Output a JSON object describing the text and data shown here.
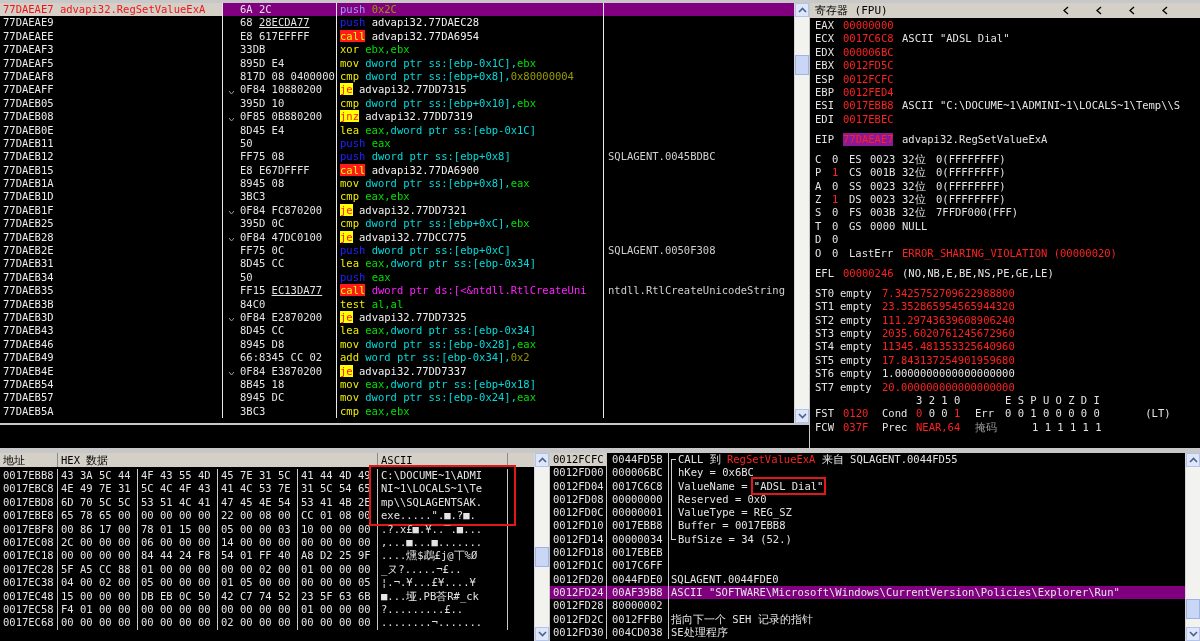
{
  "disassembly": {
    "rows": [
      {
        "address": "77DAEAE7",
        "label": "advapi32.RegSetValueExA",
        "current": true,
        "selected": true,
        "jump": false,
        "hex": "6A 2C",
        "reloc": false,
        "kind": "push",
        "mnemonic": "push",
        "operands": [
          {
            "kind": "imm",
            "text": "0x2C"
          }
        ]
      },
      {
        "address": "77DAEAE9",
        "current": false,
        "selected": false,
        "jump": false,
        "hex": "68 28ECDA77",
        "reloc": true,
        "kind": "push",
        "mnemonic": "push",
        "operands": [
          {
            "kind": "addr",
            "text": "advapi32.77DAEC28"
          }
        ]
      },
      {
        "address": "77DAEAEE",
        "current": false,
        "selected": false,
        "jump": false,
        "hex": "E8 617EFFFF",
        "reloc": false,
        "kind": "call",
        "mnemonic": "call",
        "operands": [
          {
            "kind": "addr",
            "text": "advapi32.77DA6954"
          }
        ]
      },
      {
        "address": "77DAEAF3",
        "current": false,
        "selected": false,
        "jump": false,
        "hex": "33DB",
        "reloc": false,
        "kind": "op",
        "mnemonic": "xor",
        "operands": [
          {
            "kind": "reg",
            "text": "ebx,ebx"
          }
        ]
      },
      {
        "address": "77DAEAF5",
        "current": false,
        "selected": false,
        "jump": false,
        "hex": "895D E4",
        "reloc": false,
        "kind": "op",
        "mnemonic": "mov",
        "operands": [
          {
            "kind": "mem",
            "text": "dword ptr ss:[ebp-0x1C],"
          },
          {
            "kind": "reg",
            "text": "ebx"
          }
        ]
      },
      {
        "address": "77DAEAF8",
        "current": false,
        "selected": false,
        "jump": false,
        "hex": "817D 08 0400000",
        "reloc": false,
        "kind": "op",
        "mnemonic": "cmp",
        "operands": [
          {
            "kind": "mem",
            "text": "dword ptr ss:[ebp+0x8],"
          },
          {
            "kind": "imm",
            "text": "0x80000004"
          }
        ]
      },
      {
        "address": "77DAEAFF",
        "current": false,
        "selected": false,
        "jump": true,
        "hex": "0F84 10880200",
        "reloc": false,
        "kind": "jump",
        "mnemonic": "je",
        "operands": [
          {
            "kind": "addr",
            "text": "advapi32.77DD7315"
          }
        ]
      },
      {
        "address": "77DAEB05",
        "current": false,
        "selected": false,
        "jump": false,
        "hex": "395D 10",
        "reloc": false,
        "kind": "op",
        "mnemonic": "cmp",
        "operands": [
          {
            "kind": "mem",
            "text": "dword ptr ss:[ebp+0x10],"
          },
          {
            "kind": "reg",
            "text": "ebx"
          }
        ]
      },
      {
        "address": "77DAEB08",
        "current": false,
        "selected": false,
        "jump": true,
        "hex": "0F85 0B880200",
        "reloc": false,
        "kind": "jump",
        "mnemonic": "jnz",
        "operands": [
          {
            "kind": "addr",
            "text": "advapi32.77DD7319"
          }
        ]
      },
      {
        "address": "77DAEB0E",
        "current": false,
        "selected": false,
        "jump": false,
        "hex": "8D45 E4",
        "reloc": false,
        "kind": "op",
        "mnemonic": "lea",
        "operands": [
          {
            "kind": "reg",
            "text": "eax,"
          },
          {
            "kind": "mem",
            "text": "dword ptr ss:[ebp-0x1C]"
          }
        ]
      },
      {
        "address": "77DAEB11",
        "current": false,
        "selected": false,
        "jump": false,
        "hex": "50",
        "reloc": false,
        "kind": "push",
        "mnemonic": "push",
        "operands": [
          {
            "kind": "reg",
            "text": "eax"
          }
        ]
      },
      {
        "address": "77DAEB12",
        "current": false,
        "selected": false,
        "jump": false,
        "hex": "FF75 08",
        "reloc": false,
        "kind": "push",
        "mnemonic": "push",
        "operands": [
          {
            "kind": "mem",
            "text": "dword ptr ss:[ebp+0x8]"
          }
        ],
        "comment": "SQLAGENT.0045BDBC"
      },
      {
        "address": "77DAEB15",
        "current": false,
        "selected": false,
        "jump": false,
        "hex": "E8 E67DFFFF",
        "reloc": false,
        "kind": "call",
        "mnemonic": "call",
        "operands": [
          {
            "kind": "addr",
            "text": "advapi32.77DA6900"
          }
        ]
      },
      {
        "address": "77DAEB1A",
        "current": false,
        "selected": false,
        "jump": false,
        "hex": "8945 08",
        "reloc": false,
        "kind": "op",
        "mnemonic": "mov",
        "operands": [
          {
            "kind": "mem",
            "text": "dword ptr ss:[ebp+0x8],"
          },
          {
            "kind": "reg",
            "text": "eax"
          }
        ]
      },
      {
        "address": "77DAEB1D",
        "current": false,
        "selected": false,
        "jump": false,
        "hex": "3BC3",
        "reloc": false,
        "kind": "op",
        "mnemonic": "cmp",
        "operands": [
          {
            "kind": "reg",
            "text": "eax,ebx"
          }
        ]
      },
      {
        "address": "77DAEB1F",
        "current": false,
        "selected": false,
        "jump": true,
        "hex": "0F84 FC870200",
        "reloc": false,
        "kind": "jump",
        "mnemonic": "je",
        "operands": [
          {
            "kind": "addr",
            "text": "advapi32.77DD7321"
          }
        ]
      },
      {
        "address": "77DAEB25",
        "current": false,
        "selected": false,
        "jump": false,
        "hex": "395D 0C",
        "reloc": false,
        "kind": "op",
        "mnemonic": "cmp",
        "operands": [
          {
            "kind": "mem",
            "text": "dword ptr ss:[ebp+0xC],"
          },
          {
            "kind": "reg",
            "text": "ebx"
          }
        ]
      },
      {
        "address": "77DAEB28",
        "current": false,
        "selected": false,
        "jump": true,
        "hex": "0F84 47DC0100",
        "reloc": false,
        "kind": "jump",
        "mnemonic": "je",
        "operands": [
          {
            "kind": "addr",
            "text": "advapi32.77DCC775"
          }
        ]
      },
      {
        "address": "77DAEB2E",
        "current": false,
        "selected": false,
        "jump": false,
        "hex": "FF75 0C",
        "reloc": false,
        "kind": "push",
        "mnemonic": "push",
        "operands": [
          {
            "kind": "mem",
            "text": "dword ptr ss:[ebp+0xC]"
          }
        ],
        "comment": "SQLAGENT.0050F308"
      },
      {
        "address": "77DAEB31",
        "current": false,
        "selected": false,
        "jump": false,
        "hex": "8D45 CC",
        "reloc": false,
        "kind": "op",
        "mnemonic": "lea",
        "operands": [
          {
            "kind": "reg",
            "text": "eax,"
          },
          {
            "kind": "mem",
            "text": "dword ptr ss:[ebp-0x34]"
          }
        ]
      },
      {
        "address": "77DAEB34",
        "current": false,
        "selected": false,
        "jump": false,
        "hex": "50",
        "reloc": false,
        "kind": "push",
        "mnemonic": "push",
        "operands": [
          {
            "kind": "reg",
            "text": "eax"
          }
        ]
      },
      {
        "address": "77DAEB35",
        "current": false,
        "selected": false,
        "jump": false,
        "hex": "FF15 EC13DA77",
        "reloc": true,
        "kind": "call",
        "mnemonic": "call",
        "operands": [
          {
            "kind": "ind",
            "text": "dword ptr ds:[<&ntdll.RtlCreateUni"
          }
        ],
        "comment": "ntdll.RtlCreateUnicodeString"
      },
      {
        "address": "77DAEB3B",
        "current": false,
        "selected": false,
        "jump": false,
        "hex": "84C0",
        "reloc": false,
        "kind": "op",
        "mnemonic": "test",
        "operands": [
          {
            "kind": "reg",
            "text": "al,al"
          }
        ]
      },
      {
        "address": "77DAEB3D",
        "current": false,
        "selected": false,
        "jump": true,
        "hex": "0F84 E2870200",
        "reloc": false,
        "kind": "jump",
        "mnemonic": "je",
        "operands": [
          {
            "kind": "addr",
            "text": "advapi32.77DD7325"
          }
        ]
      },
      {
        "address": "77DAEB43",
        "current": false,
        "selected": false,
        "jump": false,
        "hex": "8D45 CC",
        "reloc": false,
        "kind": "op",
        "mnemonic": "lea",
        "operands": [
          {
            "kind": "reg",
            "text": "eax,"
          },
          {
            "kind": "mem",
            "text": "dword ptr ss:[ebp-0x34]"
          }
        ]
      },
      {
        "address": "77DAEB46",
        "current": false,
        "selected": false,
        "jump": false,
        "hex": "8945 D8",
        "reloc": false,
        "kind": "op",
        "mnemonic": "mov",
        "operands": [
          {
            "kind": "mem",
            "text": "dword ptr ss:[ebp-0x28],"
          },
          {
            "kind": "reg",
            "text": "eax"
          }
        ]
      },
      {
        "address": "77DAEB49",
        "current": false,
        "selected": false,
        "jump": false,
        "hex": "66:8345 CC 02",
        "reloc": false,
        "kind": "op",
        "mnemonic": "add",
        "operands": [
          {
            "kind": "mem",
            "text": "word ptr ss:[ebp-0x34],"
          },
          {
            "kind": "imm",
            "text": "0x2"
          }
        ]
      },
      {
        "address": "77DAEB4E",
        "current": false,
        "selected": false,
        "jump": true,
        "hex": "0F84 E3870200",
        "reloc": false,
        "kind": "jump",
        "mnemonic": "je",
        "operands": [
          {
            "kind": "addr",
            "text": "advapi32.77DD7337"
          }
        ]
      },
      {
        "address": "77DAEB54",
        "current": false,
        "selected": false,
        "jump": false,
        "hex": "8B45 18",
        "reloc": false,
        "kind": "op",
        "mnemonic": "mov",
        "operands": [
          {
            "kind": "reg",
            "text": "eax,"
          },
          {
            "kind": "mem",
            "text": "dword ptr ss:[ebp+0x18]"
          }
        ]
      },
      {
        "address": "77DAEB57",
        "current": false,
        "selected": false,
        "jump": false,
        "hex": "8945 DC",
        "reloc": false,
        "kind": "op",
        "mnemonic": "mov",
        "operands": [
          {
            "kind": "mem",
            "text": "dword ptr ss:[ebp-0x24],"
          },
          {
            "kind": "reg",
            "text": "eax"
          }
        ]
      },
      {
        "address": "77DAEB5A",
        "current": false,
        "selected": false,
        "jump": false,
        "hex": "3BC3",
        "reloc": false,
        "kind": "op",
        "mnemonic": "cmp",
        "operands": [
          {
            "kind": "reg",
            "text": "eax,ebx"
          }
        ]
      }
    ]
  },
  "registers": {
    "title": "寄存器 (FPU)",
    "general": [
      {
        "name": "EAX",
        "value": "00000000",
        "changed": true
      },
      {
        "name": "ECX",
        "value": "0017C6C8",
        "changed": true,
        "comment": "ASCII \"ADSL Dial\""
      },
      {
        "name": "EDX",
        "value": "000006BC",
        "changed": true
      },
      {
        "name": "EBX",
        "value": "0012FD5C",
        "changed": true
      },
      {
        "name": "ESP",
        "value": "0012FCFC",
        "changed": true
      },
      {
        "name": "EBP",
        "value": "0012FED4",
        "changed": true
      },
      {
        "name": "ESI",
        "value": "0017EBB8",
        "changed": true,
        "comment": "ASCII \"C:\\DOCUME~1\\ADMINI~1\\LOCALS~1\\Temp\\\\S"
      },
      {
        "name": "EDI",
        "value": "0017EBEC",
        "changed": true
      }
    ],
    "eip": {
      "name": "EIP",
      "value": "77DAEAE7",
      "selected": true,
      "comment": "advapi32.RegSetValueExA"
    },
    "flags": [
      {
        "name": "C",
        "value": "0",
        "changed": false,
        "segment": {
          "name": "ES",
          "selector": "0023",
          "bits": "32位",
          "base": "0(FFFFFFFF)"
        }
      },
      {
        "name": "P",
        "value": "1",
        "changed": true,
        "segment": {
          "name": "CS",
          "selector": "001B",
          "bits": "32位",
          "base": "0(FFFFFFFF)"
        }
      },
      {
        "name": "A",
        "value": "0",
        "changed": false,
        "segment": {
          "name": "SS",
          "selector": "0023",
          "bits": "32位",
          "base": "0(FFFFFFFF)"
        }
      },
      {
        "name": "Z",
        "value": "1",
        "changed": true,
        "segment": {
          "name": "DS",
          "selector": "0023",
          "bits": "32位",
          "base": "0(FFFFFFFF)"
        }
      },
      {
        "name": "S",
        "value": "0",
        "changed": false,
        "segment": {
          "name": "FS",
          "selector": "003B",
          "bits": "32位",
          "base": "7FFDF000(FFF)"
        }
      },
      {
        "name": "T",
        "value": "0",
        "changed": false,
        "segment": {
          "name": "GS",
          "selector": "0000",
          "note": "NULL"
        }
      },
      {
        "name": "D",
        "value": "0",
        "changed": false
      },
      {
        "name": "O",
        "value": "0",
        "changed": false,
        "last_error": {
          "label": "LastErr",
          "value": "ERROR_SHARING_VIOLATION (00000020)"
        }
      }
    ],
    "efl": {
      "name": "EFL",
      "value": "00000246",
      "changed": true,
      "comment": "(NO,NB,E,BE,NS,PE,GE,LE)"
    },
    "fpu_stack": [
      {
        "name": "ST0",
        "tag": "empty",
        "value": "7.3425752709622988800",
        "changed": true
      },
      {
        "name": "ST1",
        "tag": "empty",
        "value": "23.352865954565944320",
        "changed": true
      },
      {
        "name": "ST2",
        "tag": "empty",
        "value": "111.29743639608906240",
        "changed": true
      },
      {
        "name": "ST3",
        "tag": "empty",
        "value": "2035.6020761245672960",
        "changed": true
      },
      {
        "name": "ST4",
        "tag": "empty",
        "value": "11345.481353325640960",
        "changed": true
      },
      {
        "name": "ST5",
        "tag": "empty",
        "value": "17.843137254901959680",
        "changed": true
      },
      {
        "name": "ST6",
        "tag": "empty",
        "value": "1.0000000000000000000",
        "changed": false
      },
      {
        "name": "ST7",
        "tag": "empty",
        "value": "20.000000000000000000",
        "changed": true
      }
    ],
    "bit_header": {
      "condition": "3 2 1 0",
      "errors": "E S P U O Z D I"
    },
    "fst": {
      "name": "FST",
      "value": "0120",
      "changed": true,
      "cond_label": "Cond",
      "cond": [
        {
          "value": "0",
          "changed": true
        },
        {
          "value": "0",
          "changed": false
        },
        {
          "value": "0",
          "changed": false
        },
        {
          "value": "1",
          "changed": true
        }
      ],
      "err_label": "Err",
      "err": "0 0 1 0 0 0 0 0",
      "note": "(LT)"
    },
    "fcw": {
      "name": "FCW",
      "value": "037F",
      "changed": true,
      "prec_label": "Prec",
      "prec": "NEAR,64",
      "prec_changed": true,
      "mask_label": "掩码",
      "mask": "1 1 1 1 1 1"
    }
  },
  "dump": {
    "columns": [
      "地址",
      "HEX 数据",
      "ASCII"
    ],
    "rows": [
      {
        "address": "0017EBB8",
        "bytes": [
          "43 3A 5C 44",
          "4F 43 55 4D",
          "45 7E 31 5C",
          "41 44 4D 49"
        ],
        "ascii": "C:\\DOCUME~1\\ADMI",
        "boxed": true
      },
      {
        "address": "0017EBC8",
        "bytes": [
          "4E 49 7E 31",
          "5C 4C 4F 43",
          "41 4C 53 7E",
          "31 5C 54 65"
        ],
        "ascii": "NI~1\\LOCALS~1\\Te",
        "boxed": true
      },
      {
        "address": "0017EBD8",
        "bytes": [
          "6D 70 5C 5C",
          "53 51 4C 41",
          "47 45 4E 54",
          "53 41 4B 2E"
        ],
        "ascii": "mp\\\\SQLAGENTSAK.",
        "boxed": true
      },
      {
        "address": "0017EBE8",
        "bytes": [
          "65 78 65 00",
          "00 00 00 00",
          "22 00 08 00",
          "CC 01 08 00"
        ],
        "ascii": "exe.....\".■.?■.",
        "boxed": true
      },
      {
        "address": "0017EBF8",
        "bytes": [
          "00 86 17 00",
          "78 01 15 00",
          "05 00 00 03",
          "10 00 00 00"
        ],
        "ascii": ".?.x£■.¥..‾.■...",
        "boxed": false
      },
      {
        "address": "0017EC08",
        "bytes": [
          "2C 00 00 00",
          "06 00 00 00",
          "14 00 00 00",
          "00 00 00 00"
        ],
        "ascii": ",...■...■.......",
        "boxed": false
      },
      {
        "address": "0017EC18",
        "bytes": [
          "00 00 00 00",
          "84 44 24 F8",
          "54 01 FF 40",
          "A8 D2 25 9F"
        ],
        "ascii": "....燻$鵡£j@丅%Ø",
        "boxed": false
      },
      {
        "address": "0017EC28",
        "bytes": [
          "5F A5 CC 88",
          "01 00 00 00",
          "00 00 02 00",
          "01 00 00 00"
        ],
        "ascii": "_ヌ?.....¬£..",
        "boxed": false
      },
      {
        "address": "0017EC38",
        "bytes": [
          "04 00 02 00",
          "05 00 00 00",
          "01 05 00 00",
          "00 00 00 05"
        ],
        "ascii": "¦.¬.¥...£¥....¥",
        "boxed": false
      },
      {
        "address": "0017EC48",
        "bytes": [
          "15 00 00 00",
          "DB EB 0C 50",
          "42 C7 74 52",
          "23 5F 63 6B"
        ],
        "ascii": "■...垭.PB荅R#_ck",
        "boxed": false
      },
      {
        "address": "0017EC58",
        "bytes": [
          "F4 01 00 00",
          "00 00 00 00",
          "00 00 00 00",
          "01 00 00 00"
        ],
        "ascii": "?.........£..",
        "boxed": false
      },
      {
        "address": "0017EC68",
        "bytes": [
          "00 00 00 00",
          "00 00 00 00",
          "02 00 00 00",
          "00 00 00 00"
        ],
        "ascii": "........¬.......",
        "boxed": false
      }
    ]
  },
  "stack": {
    "rows": [
      {
        "address": "0012FCFC",
        "value": "0044FD5B",
        "current": true,
        "selected": false,
        "kind": "top",
        "comment": [
          {
            "kind": "plain",
            "text": "CALL 到 "
          },
          {
            "kind": "api",
            "text": "RegSetValueExA"
          },
          {
            "kind": "plain",
            "text": " 来自 SQLAGENT.0044FD55"
          }
        ]
      },
      {
        "address": "0012FD00",
        "value": "000006BC",
        "current": false,
        "selected": false,
        "kind": "mid",
        "comment": [
          {
            "kind": "plain",
            "text": "hKey = 0x6BC"
          }
        ]
      },
      {
        "address": "0012FD04",
        "value": "0017C6C8",
        "current": false,
        "selected": false,
        "kind": "mid",
        "comment": [
          {
            "kind": "plain",
            "text": "ValueName = "
          },
          {
            "kind": "boxed",
            "text": "\"ADSL Dial\""
          }
        ]
      },
      {
        "address": "0012FD08",
        "value": "00000000",
        "current": false,
        "selected": false,
        "kind": "mid",
        "comment": [
          {
            "kind": "plain",
            "text": "Reserved = 0x0"
          }
        ]
      },
      {
        "address": "0012FD0C",
        "value": "00000001",
        "current": false,
        "selected": false,
        "kind": "mid",
        "comment": [
          {
            "kind": "plain",
            "text": "ValueType = REG_SZ"
          }
        ]
      },
      {
        "address": "0012FD10",
        "value": "0017EBB8",
        "current": false,
        "selected": false,
        "kind": "mid",
        "comment": [
          {
            "kind": "plain",
            "text": "Buffer = 0017EBB8"
          }
        ]
      },
      {
        "address": "0012FD14",
        "value": "00000034",
        "current": false,
        "selected": false,
        "kind": "bottom",
        "comment": [
          {
            "kind": "plain",
            "text": "BufSize = 34 (52.)"
          }
        ]
      },
      {
        "address": "0012FD18",
        "value": "0017EBEB",
        "current": false,
        "selected": false,
        "kind": "plain"
      },
      {
        "address": "0012FD1C",
        "value": "0017C6FF",
        "current": false,
        "selected": false,
        "kind": "plain"
      },
      {
        "address": "0012FD20",
        "value": "0044FDE0",
        "current": false,
        "selected": false,
        "kind": "plain",
        "comment": [
          {
            "kind": "plain",
            "text": "SQLAGENT.0044FDE0"
          }
        ]
      },
      {
        "address": "0012FD24",
        "value": "00AF39B8",
        "current": false,
        "selected": true,
        "kind": "plain",
        "comment": [
          {
            "kind": "plain",
            "text": "ASCII \"SOFTWARE\\Microsoft\\Windows\\CurrentVersion\\Policies\\Explorer\\Run\""
          }
        ]
      },
      {
        "address": "0012FD28",
        "value": "80000002",
        "current": false,
        "selected": false,
        "kind": "plain"
      },
      {
        "address": "0012FD2C",
        "value": "0012FFB0",
        "current": false,
        "selected": false,
        "kind": "plain",
        "comment": [
          {
            "kind": "plain",
            "text": "指向下一个 SEH 记录的指针"
          }
        ]
      },
      {
        "address": "0012FD30",
        "value": "004CD038",
        "current": false,
        "selected": false,
        "kind": "plain",
        "comment": [
          {
            "kind": "plain",
            "text": "SE处理程序"
          }
        ]
      }
    ]
  }
}
